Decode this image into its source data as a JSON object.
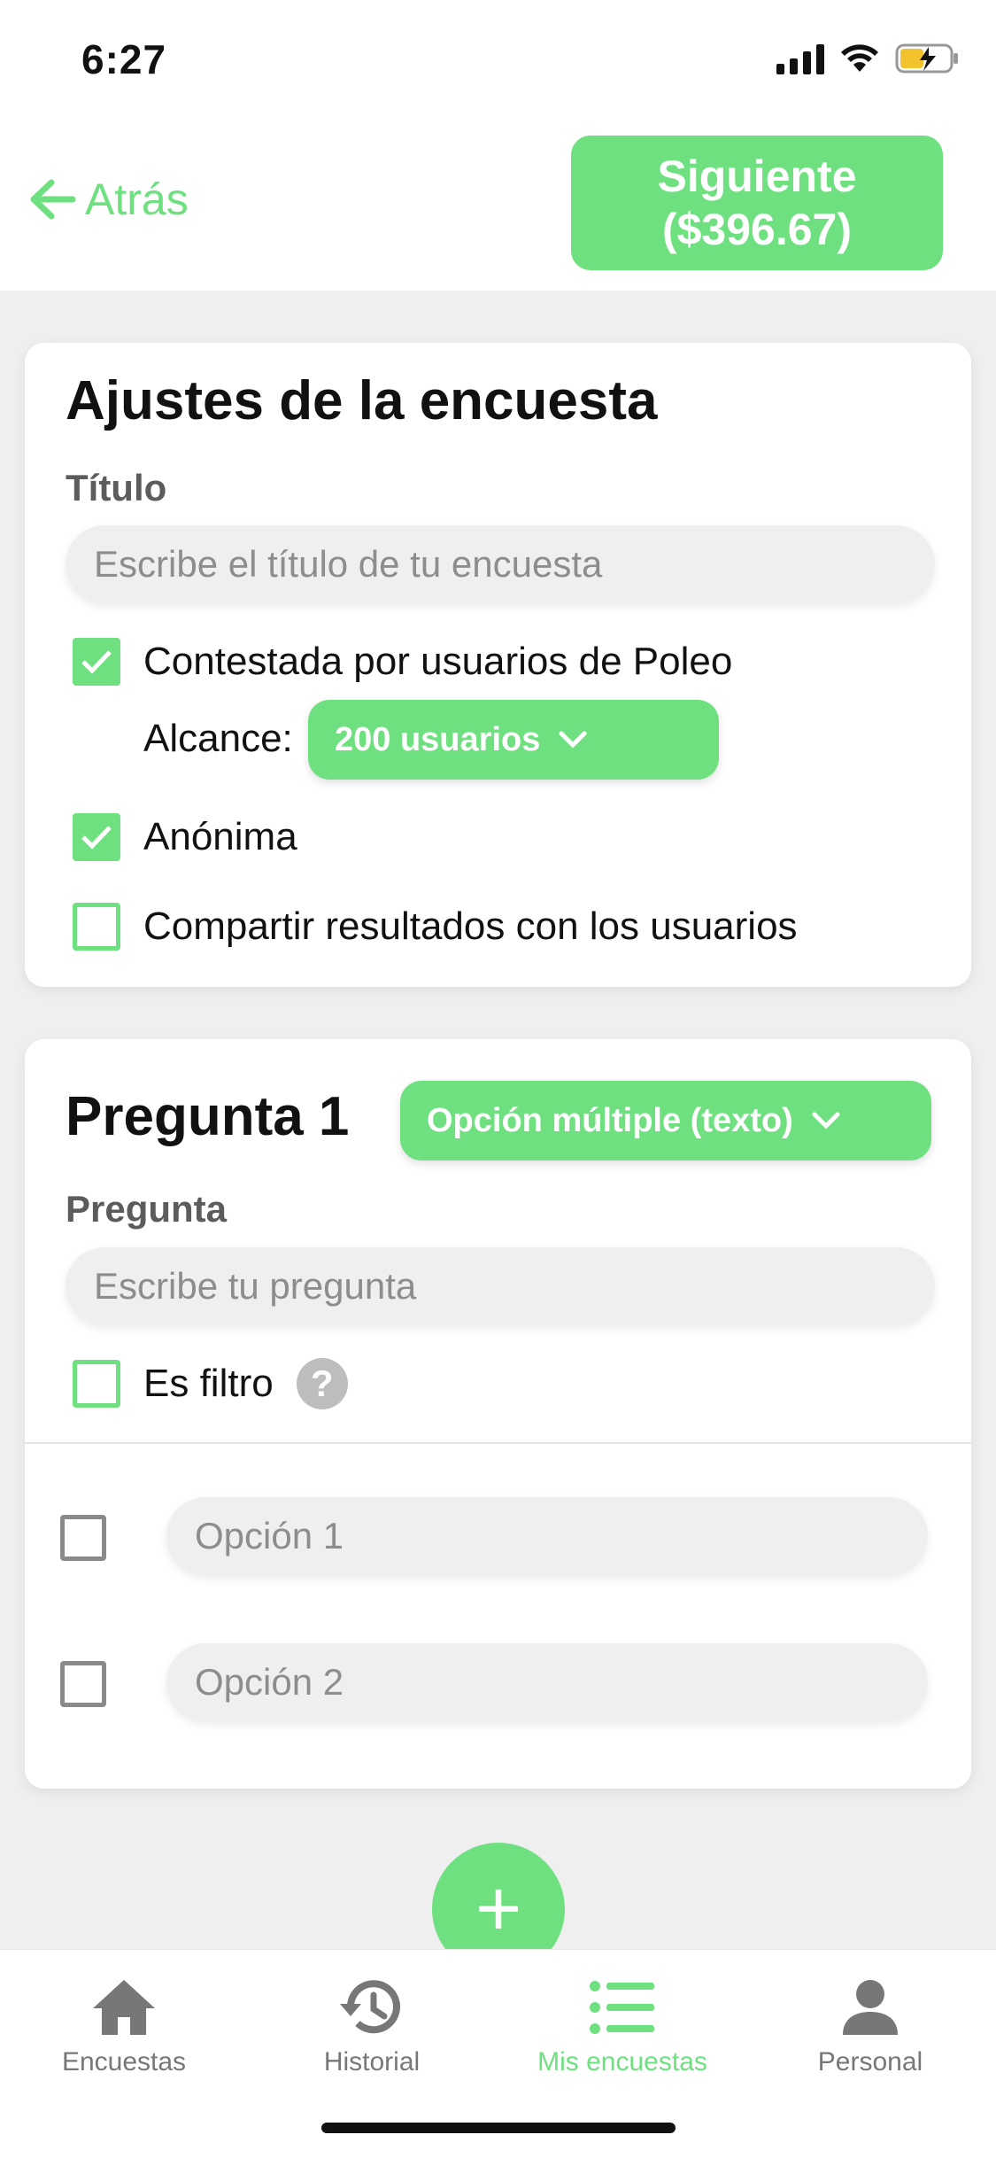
{
  "status_bar": {
    "time": "6:27"
  },
  "header": {
    "back_label": "Atrás",
    "next_label_line1": "Siguiente",
    "next_label_line2": "($396.67)"
  },
  "survey_settings": {
    "title": "Ajustes de la encuesta",
    "title_field_label": "Título",
    "title_placeholder": "Escribe el título de tu encuesta",
    "poleo_users_label": "Contestada por usuarios de Poleo",
    "poleo_users_checked": true,
    "reach_label": "Alcance:",
    "reach_value": "200 usuarios",
    "anonymous_label": "Anónima",
    "anonymous_checked": true,
    "share_results_label": "Compartir resultados con los usuarios",
    "share_results_checked": false
  },
  "question1": {
    "title": "Pregunta 1",
    "type_value": "Opción múltiple (texto)",
    "question_label": "Pregunta",
    "question_placeholder": "Escribe tu pregunta",
    "filter_label": "Es filtro",
    "help_symbol": "?",
    "options": [
      {
        "placeholder": "Opción 1"
      },
      {
        "placeholder": "Opción 2"
      }
    ]
  },
  "fab": {
    "symbol": "+"
  },
  "tabbar": {
    "items": [
      {
        "label": "Encuestas",
        "icon": "home-icon"
      },
      {
        "label": "Historial",
        "icon": "history-icon"
      },
      {
        "label": "Mis encuestas",
        "icon": "list-icon",
        "active": true
      },
      {
        "label": "Personal",
        "icon": "person-icon"
      }
    ]
  },
  "colors": {
    "accent": "#6ee07f",
    "background": "#efefef"
  }
}
